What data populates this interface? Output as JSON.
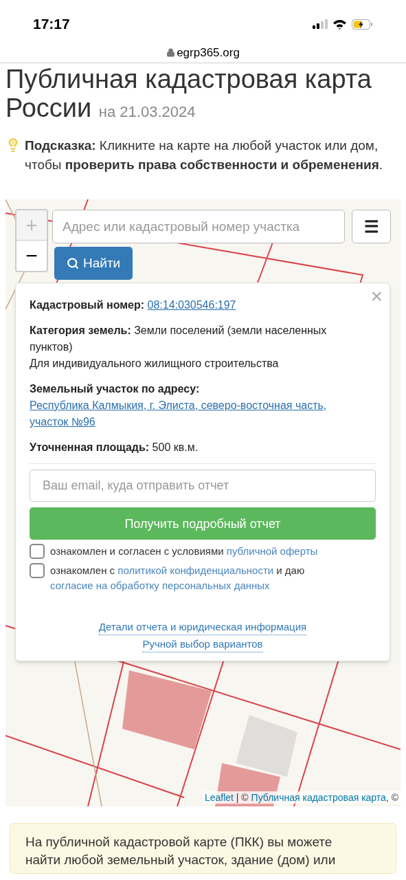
{
  "status_bar": {
    "time": "17:17"
  },
  "browser": {
    "url": "egrp365.org"
  },
  "page": {
    "title": "Публичная кадастровая карта России",
    "date": "на 21.03.2024",
    "hint": "**Подсказка:** Кликните на карте на любой участок или дом, чтобы **проверить права собственности и обременения**."
  },
  "map": {
    "zoom_in": "+",
    "zoom_out": "−",
    "search": {
      "placeholder": "Адрес или кадастровый номер участка"
    },
    "menu_button": "☰",
    "find_button": "Найти",
    "popup": {
      "close": "×",
      "rows": [
        {
          "kind": "link",
          "label": "Кадастровый номер:",
          "value": "08:14:030546:197"
        },
        {
          "kind": "text",
          "label": "Категория земель:",
          "value": "Земли поселений (земли населенных пунктов)",
          "note": "Для индивидуального жилищного строительства"
        },
        {
          "kind": "link",
          "label": "Земельный участок по адресу:",
          "value": "Республика Калмыкия, г. Элиста, северо-восточная часть, участок №96"
        },
        {
          "kind": "text",
          "label": "Уточненная площадь:",
          "value": "500 кв.м."
        }
      ],
      "email": {
        "placeholder": "Ваш email, куда отправить отчет"
      },
      "submit_button": "Получить подробный отчет",
      "agreements": [
        {
          "checked": false,
          "parts": [
            {
              "text": "ознакомлен и согласен с условиями",
              "link": false
            },
            {
              "text": "публичной оферты",
              "link": true
            }
          ]
        },
        {
          "checked": false,
          "parts": [
            {
              "text": "ознакомлен с",
              "link": false
            },
            {
              "text": "политикой конфиденциальности",
              "link": true
            },
            {
              "text": "и даю",
              "link": false
            },
            {
              "text": "согласие на обработку персональных данных",
              "link": true
            }
          ]
        }
      ],
      "footer_links": [
        "Детали отчета и юридическая информация",
        "Ручной выбор вариантов"
      ]
    },
    "attribution": {
      "leaflet": "Leaflet",
      "separator": "| ©",
      "source": "Публичная кадастровая карта",
      "tail": ", ©"
    }
  },
  "info_box": {
    "text": "На публичной кадастровой карте (ПКК) вы можете найти любой земельный участок, здание (дом) или"
  }
}
